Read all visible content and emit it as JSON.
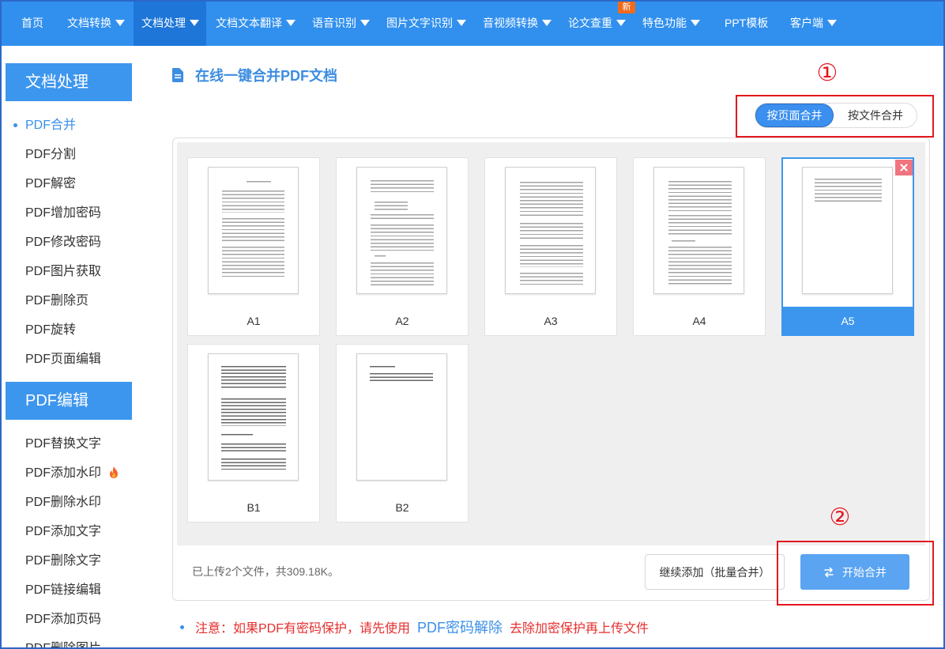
{
  "nav": {
    "items": [
      {
        "label": "首页"
      },
      {
        "label": "文档转换",
        "dropdown": true
      },
      {
        "label": "文档处理",
        "dropdown": true,
        "active": true
      },
      {
        "label": "文档文本翻译",
        "dropdown": true
      },
      {
        "label": "语音识别",
        "dropdown": true
      },
      {
        "label": "图片文字识别",
        "dropdown": true
      },
      {
        "label": "音视频转换",
        "dropdown": true
      },
      {
        "label": "论文查重",
        "dropdown": true,
        "badge": "新"
      },
      {
        "label": "特色功能",
        "dropdown": true
      },
      {
        "label": "PPT模板"
      },
      {
        "label": "客户端",
        "dropdown": true
      }
    ]
  },
  "sidebar": {
    "sections": [
      {
        "title": "文档处理",
        "items": [
          {
            "label": "PDF合并",
            "active": true
          },
          {
            "label": "PDF分割"
          },
          {
            "label": "PDF解密"
          },
          {
            "label": "PDF增加密码"
          },
          {
            "label": "PDF修改密码"
          },
          {
            "label": "PDF图片获取"
          },
          {
            "label": "PDF删除页"
          },
          {
            "label": "PDF旋转"
          },
          {
            "label": "PDF页面编辑"
          }
        ]
      },
      {
        "title": "PDF编辑",
        "items": [
          {
            "label": "PDF替换文字"
          },
          {
            "label": "PDF添加水印",
            "icon": "fire-icon"
          },
          {
            "label": "PDF删除水印"
          },
          {
            "label": "PDF添加文字"
          },
          {
            "label": "PDF删除文字"
          },
          {
            "label": "PDF链接编辑"
          },
          {
            "label": "PDF添加页码"
          },
          {
            "label": "PDF删除图片"
          }
        ]
      }
    ]
  },
  "main": {
    "title": "在线一键合并PDF文档",
    "title_icon": "document-icon",
    "merge_mode": {
      "options": [
        {
          "label": "按页面合并",
          "selected": true
        },
        {
          "label": "按文件合并",
          "selected": false
        }
      ]
    },
    "pages": [
      {
        "label": "A1"
      },
      {
        "label": "A2"
      },
      {
        "label": "A3"
      },
      {
        "label": "A4"
      },
      {
        "label": "A5",
        "selected": true,
        "remove_icon": "close-icon"
      },
      {
        "label": "B1"
      },
      {
        "label": "B2"
      }
    ],
    "upload_status": "已上传2个文件，共309.18K。",
    "add_more_button": "继续添加（批量合并）",
    "start_button": {
      "label": "开始合并",
      "icon": "swap-icon"
    },
    "notice": {
      "text_before": "注意：如果PDF有密码保护，请先使用",
      "link": "PDF密码解除",
      "text_after": "去除加密保护再上传文件"
    }
  },
  "annotations": {
    "marker_1": "①",
    "marker_2": "②"
  },
  "colors": {
    "frame": "#2b67c8",
    "nav-bg": "#3190ee",
    "nav-active": "#1d76d8",
    "accent": "#3d96ee",
    "accent-strong": "#3b8fee",
    "link": "#3a8fe8",
    "badge": "#f26a1c",
    "annotation": "#e4171f",
    "notice-red": "#e62e2e",
    "start-button": "#5aa4f2",
    "remove": "#f07480"
  }
}
